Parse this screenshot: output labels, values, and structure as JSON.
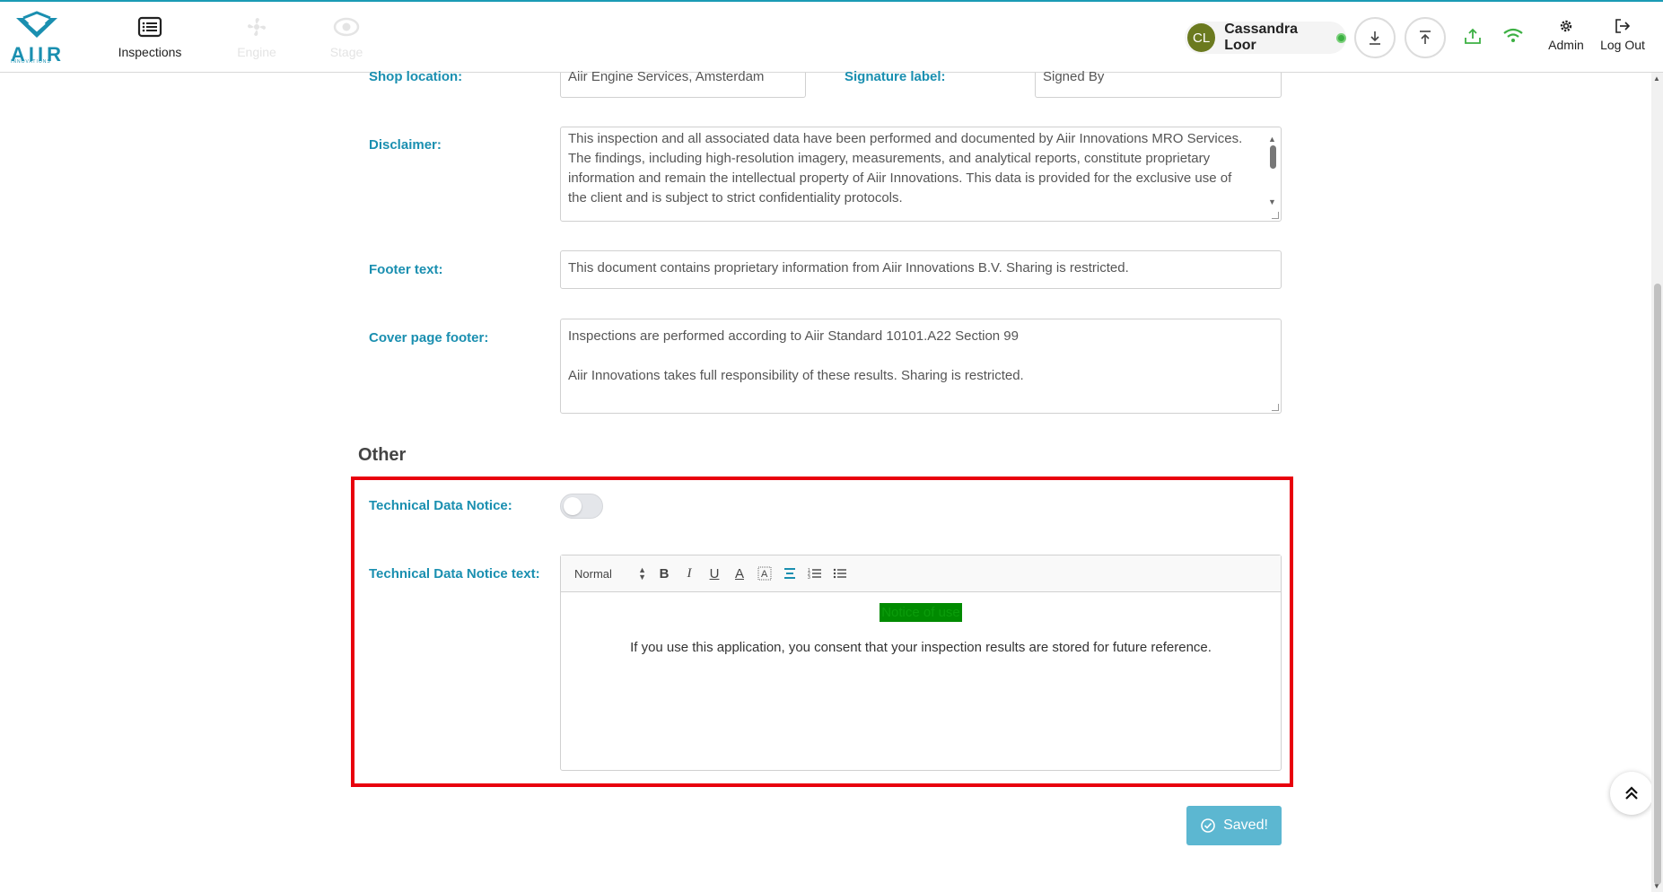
{
  "header": {
    "logo_text": "AIIR",
    "logo_sub": "INNOVATIONS",
    "nav": [
      {
        "label": "Inspections",
        "icon": "list-icon",
        "enabled": true
      },
      {
        "label": "Engine",
        "icon": "engine-icon",
        "enabled": false
      },
      {
        "label": "Stage",
        "icon": "eye-icon",
        "enabled": false
      }
    ],
    "user": {
      "initials": "CL",
      "name": "Cassandra Loor",
      "status": "online"
    },
    "admin_label": "Admin",
    "logout_label": "Log Out"
  },
  "form": {
    "shop_location_label": "Shop location:",
    "shop_location_value": "Aiir Engine Services, Amsterdam",
    "signature_label_label": "Signature label:",
    "signature_label_value": "Signed By",
    "disclaimer_label": "Disclaimer:",
    "disclaimer_value": "This inspection and all associated data have been performed and documented by Aiir Innovations MRO Services. The findings, including high-resolution imagery, measurements, and analytical reports, constitute proprietary information and remain the intellectual property of Aiir Innovations. This data is provided for the exclusive use of the client and is subject to strict confidentiality protocols.",
    "footer_text_label": "Footer text:",
    "footer_text_value": "This document contains proprietary information from Aiir Innovations B.V. Sharing is restricted.",
    "cover_footer_label": "Cover page footer:",
    "cover_footer_line1": "Inspections are performed according to Aiir Standard 10101.A22 Section 99",
    "cover_footer_line2": "Aiir Innovations takes full responsibility of these results. Sharing is restricted."
  },
  "other": {
    "section_title": "Other",
    "tdn_label": "Technical Data Notice:",
    "tdn_enabled": false,
    "tdn_text_label": "Technical Data Notice text:",
    "toolbar_format": "Normal",
    "notice_heading": "Notice of use",
    "notice_body": "If you use this application, you consent that your inspection results are stored for future reference."
  },
  "actions": {
    "saved_label": "Saved!"
  },
  "colors": {
    "accent": "#1a8fb0",
    "highlight_border": "#e8000d",
    "saved_button": "#5cb7d1",
    "notice_highlight": "#008a00"
  }
}
